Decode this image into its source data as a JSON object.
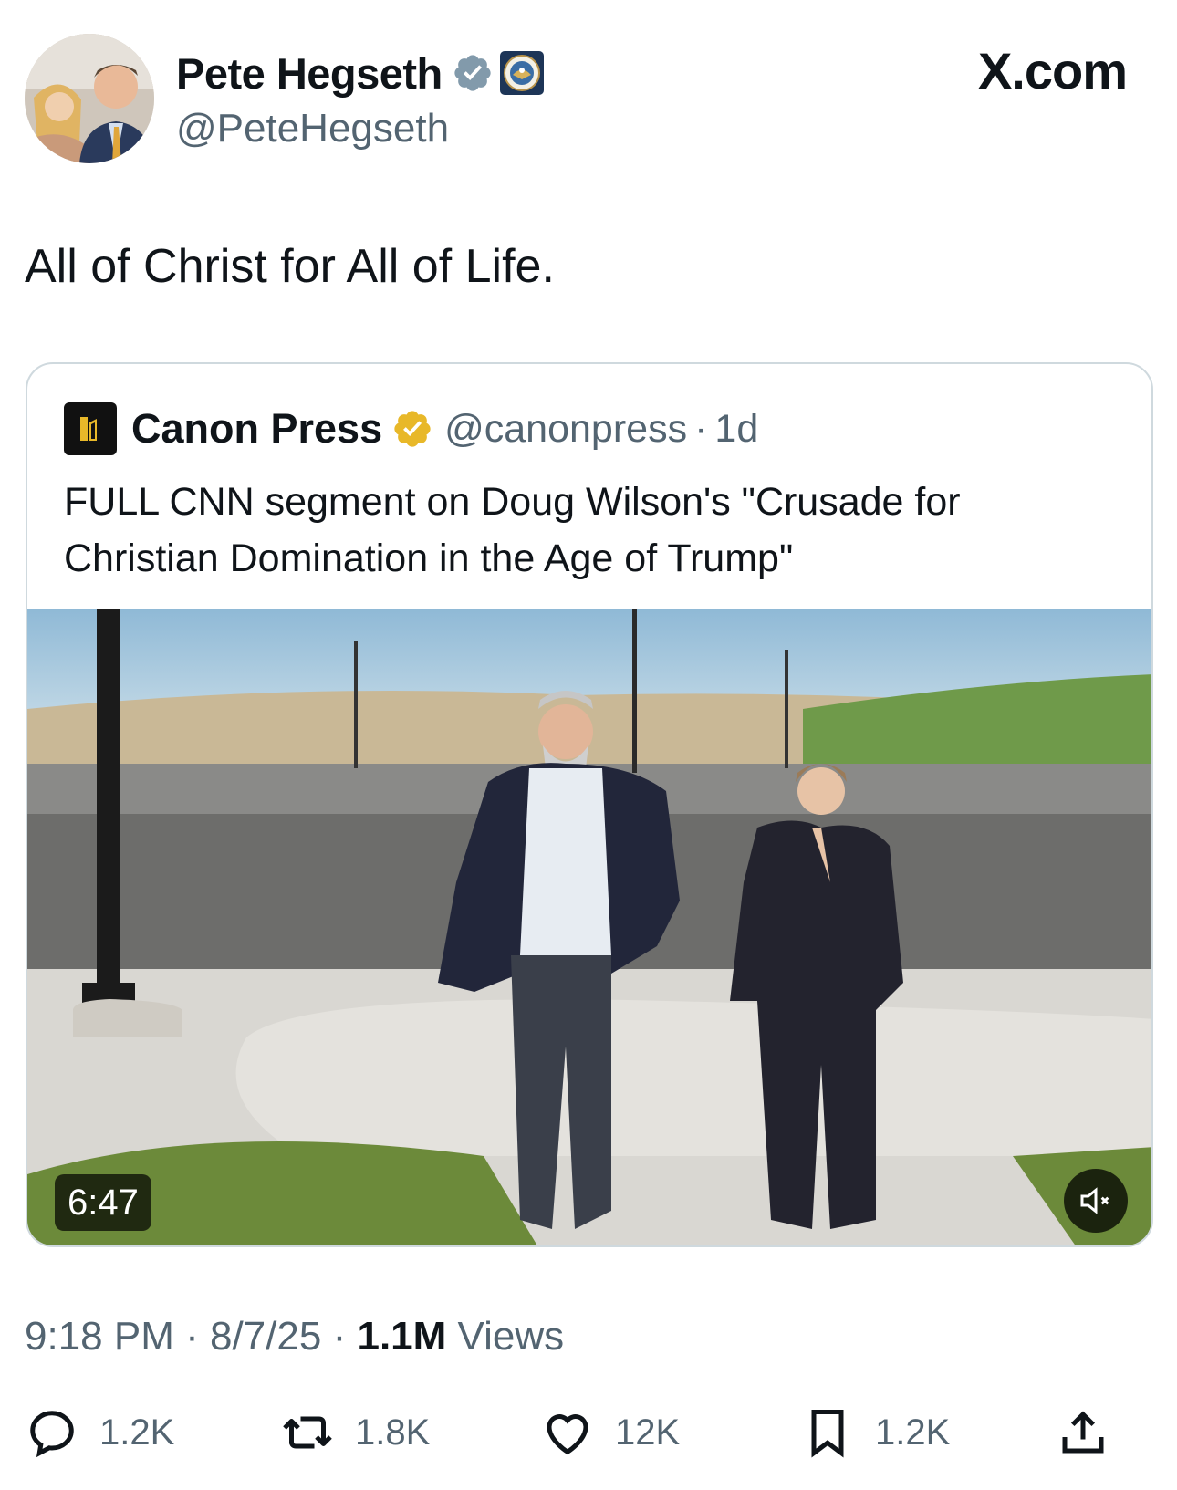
{
  "author": {
    "name": "Pete Hegseth",
    "handle": "@PeteHegseth",
    "verified_icon": "verified-badge-icon",
    "affiliation_icon": "dod-seal-icon"
  },
  "brand": {
    "label": "X.com"
  },
  "tweet": {
    "text": "All of Christ for All of Life."
  },
  "quote": {
    "name": "Canon Press",
    "handle": "@canonpress",
    "separator": "·",
    "time": "1d",
    "text": "FULL CNN segment on Doug Wilson's \"Crusade for Christian Domination in the Age of Trump\"",
    "media": {
      "duration": "6:47",
      "mute_icon": "speaker-muted-icon"
    }
  },
  "meta": {
    "time": "9:18 PM",
    "sep1": "·",
    "date": "8/7/25",
    "sep2": "·",
    "views_count": "1.1M",
    "views_label": "Views"
  },
  "actions": {
    "replies": "1.2K",
    "reposts": "1.8K",
    "likes": "12K",
    "bookmarks": "1.2K"
  },
  "colors": {
    "text": "#0f1419",
    "secondary": "#536471",
    "border": "#cfd9de",
    "verified_blue": "#829aab",
    "verified_gold": "#e8b829"
  }
}
